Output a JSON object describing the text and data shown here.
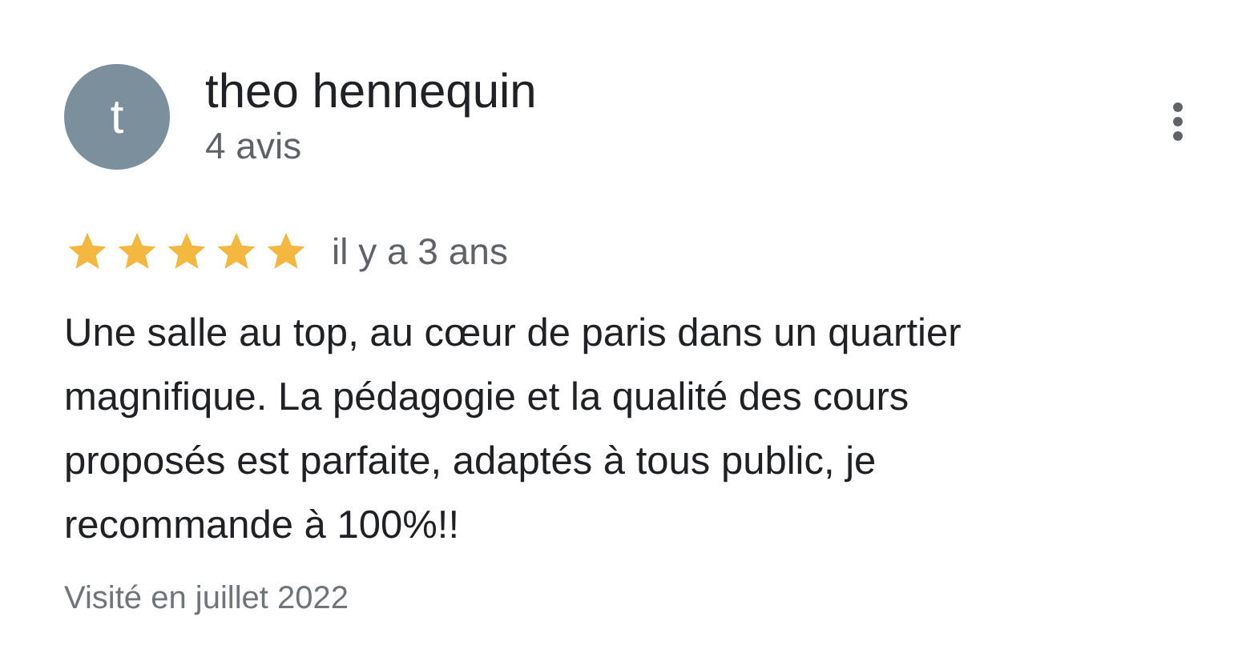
{
  "review": {
    "avatar_letter": "t",
    "author": "theo hennequin",
    "author_meta": "4 avis",
    "stars": 5,
    "time": "il y a 3 ans",
    "text": "Une salle au top, au cœur de paris dans un quartier\nmagnifique. La pédagogie et la qualité des cours\nproposés est parfaite, adaptés à tous public, je\nrecommande à 100%!!",
    "visit": "Visité en juillet 2022"
  }
}
